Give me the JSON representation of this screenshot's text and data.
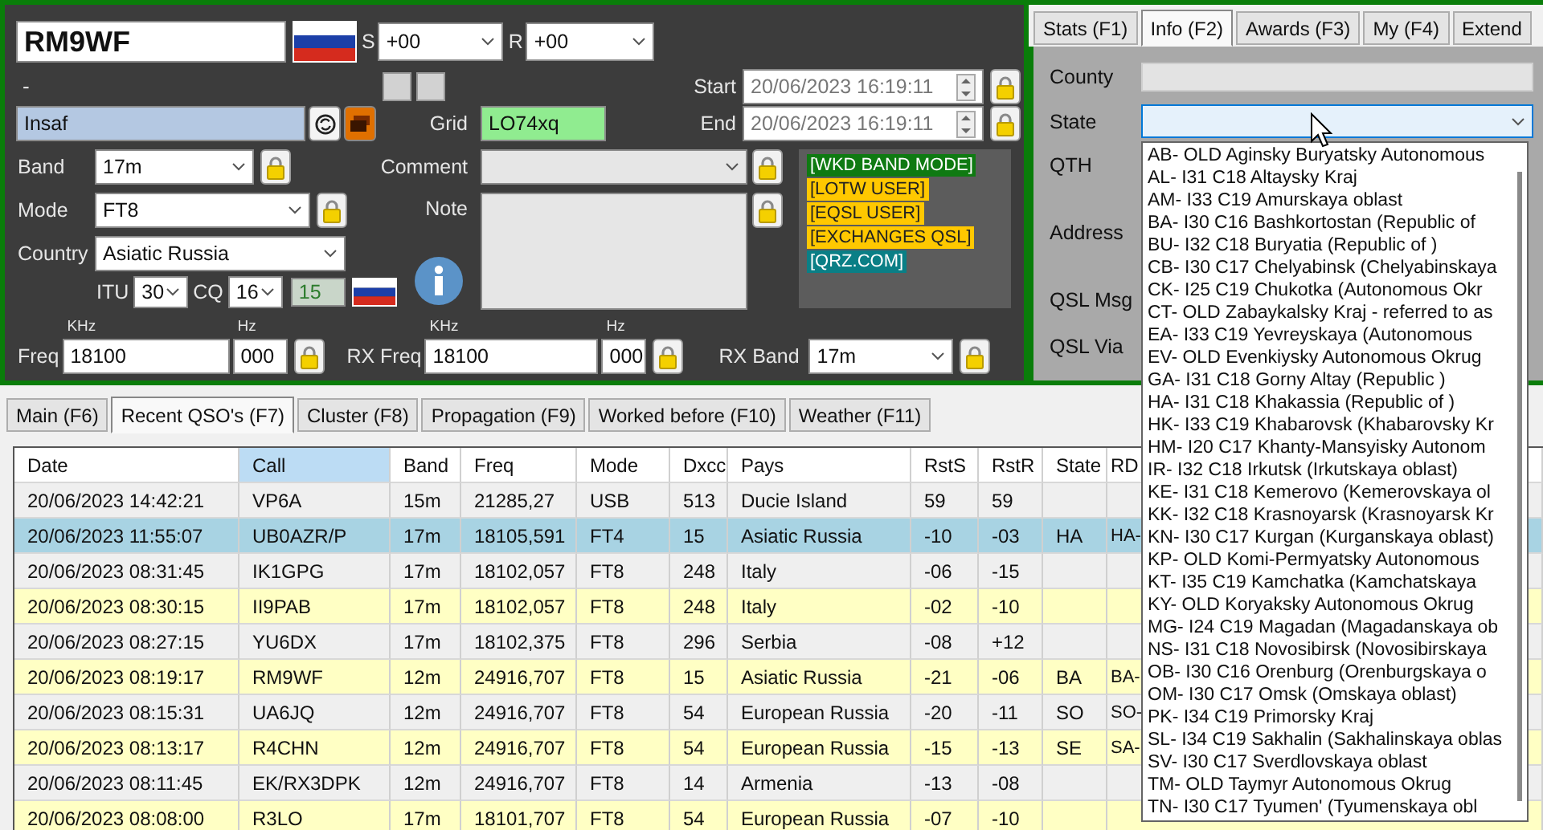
{
  "callsign": "RM9WF",
  "s_report": {
    "label": "S",
    "value": "+00"
  },
  "r_report": {
    "label": "R",
    "value": "+00"
  },
  "dash": "-",
  "name": "Insaf",
  "grid": {
    "label": "Grid",
    "value": "LO74xq"
  },
  "start": {
    "label": "Start",
    "value": "20/06/2023 16:19:11",
    "disabled": true
  },
  "end": {
    "label": "End",
    "value": "20/06/2023 16:19:11",
    "disabled": true
  },
  "band": {
    "label": "Band",
    "value": "17m"
  },
  "mode": {
    "label": "Mode",
    "value": "FT8"
  },
  "country": {
    "label": "Country",
    "value": "Asiatic Russia"
  },
  "itu": {
    "label": "ITU",
    "value": "30"
  },
  "cq": {
    "label": "CQ",
    "value": "16"
  },
  "zone": "15",
  "comment": {
    "label": "Comment"
  },
  "note": {
    "label": "Note"
  },
  "badges": [
    {
      "text": "[WKD BAND MODE]",
      "color": "#0f7a12"
    },
    {
      "text": "[LOTW USER]",
      "color": "#ffc800"
    },
    {
      "text": "[EQSL USER]",
      "color": "#ffc800"
    },
    {
      "text": "[EXCHANGES QSL]",
      "color": "#ffc800"
    },
    {
      "text": "[QRZ.COM]",
      "color": "#0a7f86"
    }
  ],
  "freq": {
    "label": "Freq",
    "khz_unit": "KHz",
    "khz": "18100",
    "hz_unit": "Hz",
    "hz": "000"
  },
  "rx_freq": {
    "label": "RX Freq",
    "khz_unit": "KHz",
    "khz": "18100",
    "hz_unit": "Hz",
    "hz": "000"
  },
  "rx_band": {
    "label": "RX Band",
    "value": "17m"
  },
  "side_tabs": [
    {
      "label": "Stats (F1)",
      "selected": false
    },
    {
      "label": "Info (F2)",
      "selected": true
    },
    {
      "label": "Awards (F3)",
      "selected": false
    },
    {
      "label": "My (F4)",
      "selected": false
    },
    {
      "label": "Extend",
      "selected": false
    }
  ],
  "info_fields": [
    {
      "label": "County",
      "kind": "field"
    },
    {
      "label": "State",
      "kind": "combo"
    },
    {
      "label": "QTH",
      "kind": "label"
    },
    {
      "label": "Address",
      "kind": "label"
    },
    {
      "label": "QSL Msg",
      "kind": "label"
    },
    {
      "label": "QSL Via",
      "kind": "label"
    }
  ],
  "state_options": [
    "AB- OLD Aginsky Buryatsky Autonomous",
    "AL- I31 C18 Altaysky Kraj",
    "AM- I33 C19 Amurskaya oblast",
    "BA- I30 C16 Bashkortostan (Republic of",
    "BU- I32 C18 Buryatia (Republic of )",
    "CB- I30 C17 Chelyabinsk (Chelyabinskaya",
    "CK- I25 C19 Chukotka (Autonomous Okr",
    "CT- OLD Zabaykalsky Kraj - referred to as",
    "EA- I33 C19 Yevreyskaya (Autonomous",
    "EV- OLD Evenkiysky Autonomous Okrug",
    "GA- I31 C18 Gorny Altay (Republic )",
    "HA- I31 C18 Khakassia (Republic of )",
    "HK- I33 C19 Khabarovsk (Khabarovsky Kr",
    "HM- I20 C17 Khanty-Mansyisky Autonom",
    "IR- I32 C18 Irkutsk (Irkutskaya oblast)",
    "KE- I31 C18 Kemerovo (Kemerovskaya ol",
    "KK- I32 C18 Krasnoyarsk (Krasnoyarsk Kr",
    "KN- I30 C17 Kurgan (Kurganskaya oblast)",
    "KP- OLD Komi-Permyatsky Autonomous",
    "KT- I35 C19 Kamchatka (Kamchatskaya",
    "KY- OLD Koryaksky Autonomous Okrug",
    "MG- I24 C19 Magadan (Magadanskaya ob",
    "NS- I31 C18 Novosibirsk (Novosibirskaya",
    "OB- I30 C16 Orenburg (Orenburgskaya o",
    "OM- I30 C17 Omsk (Omskaya oblast)",
    "PK- I34 C19 Primorsky Kraj",
    "SL- I34 C19 Sakhalin (Sakhalinskaya oblas",
    "SV- I30 C17 Sverdlovskaya oblast",
    "TM- OLD Taymyr Autonomous Okrug",
    "TN- I30 C17 Tyumen' (Tyumenskaya obl"
  ],
  "bottom_tabs": [
    {
      "label": "Main (F6)",
      "selected": false
    },
    {
      "label": "Recent QSO's (F7)",
      "selected": true
    },
    {
      "label": "Cluster (F8)",
      "selected": false
    },
    {
      "label": "Propagation (F9)",
      "selected": false
    },
    {
      "label": "Worked before (F10)",
      "selected": false
    },
    {
      "label": "Weather (F11)",
      "selected": false
    }
  ],
  "table": {
    "columns": [
      {
        "label": "Date",
        "sorted": false
      },
      {
        "label": "Call",
        "sorted": true
      },
      {
        "label": "Band",
        "sorted": false
      },
      {
        "label": "Freq",
        "sorted": false
      },
      {
        "label": "Mode",
        "sorted": false
      },
      {
        "label": "Dxcc",
        "sorted": false
      },
      {
        "label": "Pays",
        "sorted": false
      },
      {
        "label": "RstS",
        "sorted": false
      },
      {
        "label": "RstR",
        "sorted": false
      },
      {
        "label": "State",
        "sorted": false
      },
      {
        "label": "RD",
        "sorted": false
      }
    ],
    "rows": [
      {
        "selected": false,
        "highlighted": false,
        "cells": [
          "20/06/2023 14:42:21",
          "VP6A",
          "15m",
          "21285,27",
          "USB",
          "513",
          "Ducie Island",
          "59",
          "59",
          null,
          null
        ]
      },
      {
        "selected": true,
        "highlighted": false,
        "cells": [
          "20/06/2023 11:55:07",
          "UB0AZR/P",
          "17m",
          "18105,591",
          "FT4",
          "15",
          "Asiatic Russia",
          "-10",
          "-03",
          "HA",
          "HA-"
        ]
      },
      {
        "selected": false,
        "highlighted": false,
        "cells": [
          "20/06/2023 08:31:45",
          "IK1GPG",
          "17m",
          "18102,057",
          "FT8",
          "248",
          "Italy",
          "-06",
          "-15",
          null,
          null
        ]
      },
      {
        "selected": false,
        "highlighted": true,
        "cells": [
          "20/06/2023 08:30:15",
          "II9PAB",
          "17m",
          "18102,057",
          "FT8",
          "248",
          "Italy",
          "-02",
          "-10",
          null,
          null
        ]
      },
      {
        "selected": false,
        "highlighted": false,
        "cells": [
          "20/06/2023 08:27:15",
          "YU6DX",
          "17m",
          "18102,375",
          "FT8",
          "296",
          "Serbia",
          "-08",
          "+12",
          null,
          null
        ]
      },
      {
        "selected": false,
        "highlighted": true,
        "cells": [
          "20/06/2023 08:19:17",
          "RM9WF",
          "12m",
          "24916,707",
          "FT8",
          "15",
          "Asiatic Russia",
          "-21",
          "-06",
          "BA",
          "BA-"
        ]
      },
      {
        "selected": false,
        "highlighted": false,
        "cells": [
          "20/06/2023 08:15:31",
          "UA6JQ",
          "12m",
          "24916,707",
          "FT8",
          "54",
          "European Russia",
          "-20",
          "-11",
          "SO",
          "SO-"
        ]
      },
      {
        "selected": false,
        "highlighted": true,
        "cells": [
          "20/06/2023 08:13:17",
          "R4CHN",
          "12m",
          "24916,707",
          "FT8",
          "54",
          "European Russia",
          "-15",
          "-13",
          "SE",
          "SA-"
        ]
      },
      {
        "selected": false,
        "highlighted": false,
        "cells": [
          "20/06/2023 08:11:45",
          "EK/RX3DPK",
          "12m",
          "24916,707",
          "FT8",
          "14",
          "Armenia",
          "-13",
          "-08",
          null,
          null
        ]
      },
      {
        "selected": false,
        "highlighted": true,
        "cells": [
          "20/06/2023 08:08:00",
          "R3LO",
          "17m",
          "18101,707",
          "FT8",
          "54",
          "European Russia",
          "-07",
          "-10",
          null,
          null
        ]
      }
    ]
  }
}
